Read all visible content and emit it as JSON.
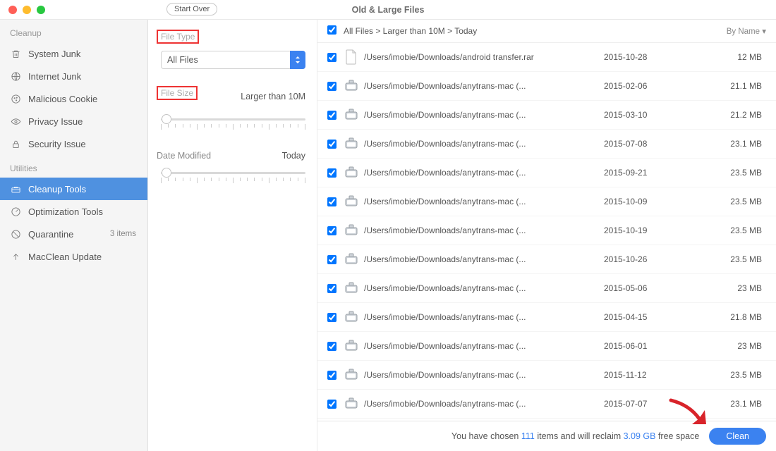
{
  "window": {
    "title": "Old & Large Files",
    "start_over": "Start Over"
  },
  "sidebar": {
    "sections": {
      "cleanup": "Cleanup",
      "utilities": "Utilities"
    },
    "items": [
      {
        "label": "System Junk"
      },
      {
        "label": "Internet Junk"
      },
      {
        "label": "Malicious Cookie"
      },
      {
        "label": "Privacy Issue"
      },
      {
        "label": "Security Issue"
      },
      {
        "label": "Cleanup Tools"
      },
      {
        "label": "Optimization Tools"
      },
      {
        "label": "Quarantine",
        "count": "3 items"
      },
      {
        "label": "MacClean Update"
      }
    ]
  },
  "panel": {
    "file_type_label": "File Type",
    "file_type_value": "All Files",
    "file_size_label": "File Size",
    "file_size_value": "Larger than 10M",
    "date_label": "Date Modified",
    "date_value": "Today"
  },
  "list": {
    "breadcrumb": "All Files > Larger than 10M > Today",
    "sort": "By Name ▾",
    "rows": [
      {
        "icon": "doc",
        "path": "/Users/imobie/Downloads/android transfer.rar",
        "date": "2015-10-28",
        "size": "12 MB"
      },
      {
        "icon": "dmg",
        "path": "/Users/imobie/Downloads/anytrans-mac (...",
        "date": "2015-02-06",
        "size": "21.1 MB"
      },
      {
        "icon": "dmg",
        "path": "/Users/imobie/Downloads/anytrans-mac (...",
        "date": "2015-03-10",
        "size": "21.2 MB"
      },
      {
        "icon": "dmg",
        "path": "/Users/imobie/Downloads/anytrans-mac (...",
        "date": "2015-07-08",
        "size": "23.1 MB"
      },
      {
        "icon": "dmg",
        "path": "/Users/imobie/Downloads/anytrans-mac (...",
        "date": "2015-09-21",
        "size": "23.5 MB"
      },
      {
        "icon": "dmg",
        "path": "/Users/imobie/Downloads/anytrans-mac (...",
        "date": "2015-10-09",
        "size": "23.5 MB"
      },
      {
        "icon": "dmg",
        "path": "/Users/imobie/Downloads/anytrans-mac (...",
        "date": "2015-10-19",
        "size": "23.5 MB"
      },
      {
        "icon": "dmg",
        "path": "/Users/imobie/Downloads/anytrans-mac (...",
        "date": "2015-10-26",
        "size": "23.5 MB"
      },
      {
        "icon": "dmg",
        "path": "/Users/imobie/Downloads/anytrans-mac (...",
        "date": "2015-05-06",
        "size": "23 MB"
      },
      {
        "icon": "dmg",
        "path": "/Users/imobie/Downloads/anytrans-mac (...",
        "date": "2015-04-15",
        "size": "21.8 MB"
      },
      {
        "icon": "dmg",
        "path": "/Users/imobie/Downloads/anytrans-mac (...",
        "date": "2015-06-01",
        "size": "23 MB"
      },
      {
        "icon": "dmg",
        "path": "/Users/imobie/Downloads/anytrans-mac (...",
        "date": "2015-11-12",
        "size": "23.5 MB"
      },
      {
        "icon": "dmg",
        "path": "/Users/imobie/Downloads/anytrans-mac (...",
        "date": "2015-07-07",
        "size": "23.1 MB"
      }
    ]
  },
  "footer": {
    "pre": "You have chosen ",
    "count": "111",
    "mid": " items and will reclaim ",
    "size": "3.09 GB",
    "post": " free space",
    "clean": "Clean"
  }
}
